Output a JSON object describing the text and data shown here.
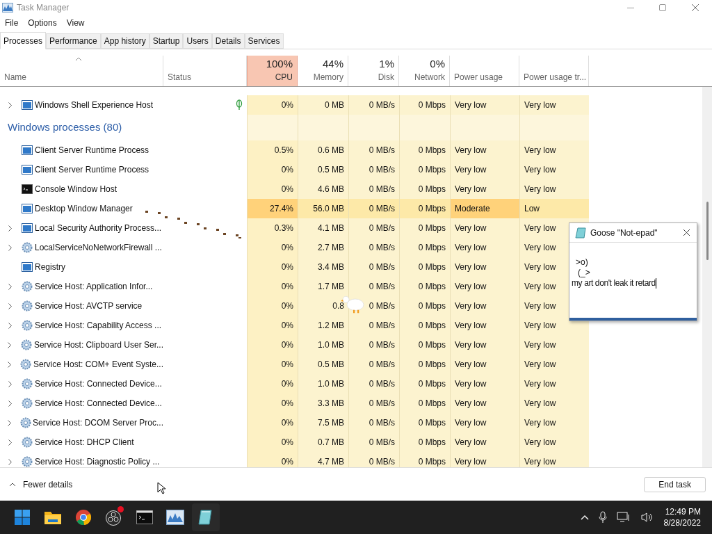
{
  "window": {
    "title": "Task Manager"
  },
  "menu": [
    "File",
    "Options",
    "View"
  ],
  "tabs": [
    {
      "label": "Processes",
      "selected": true
    },
    {
      "label": "Performance",
      "selected": false
    },
    {
      "label": "App history",
      "selected": false
    },
    {
      "label": "Startup",
      "selected": false
    },
    {
      "label": "Users",
      "selected": false
    },
    {
      "label": "Details",
      "selected": false
    },
    {
      "label": "Services",
      "selected": false
    }
  ],
  "columns": [
    {
      "name": "Name"
    },
    {
      "name": "Status"
    },
    {
      "name": "CPU",
      "total": "100%"
    },
    {
      "name": "Memory",
      "total": "44%"
    },
    {
      "name": "Disk",
      "total": "1%"
    },
    {
      "name": "Network",
      "total": "0%"
    },
    {
      "name": "Power usage"
    },
    {
      "name": "Power usage tr..."
    }
  ],
  "top_row": {
    "name": "Windows Shell Experience Host",
    "kind": "app",
    "expandable": true,
    "status_leaf": true,
    "cells": [
      "0%",
      "0 MB",
      "0 MB/s",
      "0 Mbps",
      "Very low",
      "Very low"
    ],
    "busy": false
  },
  "group": "Windows processes (80)",
  "rows": [
    {
      "name": "Client Server Runtime Process",
      "kind": "app",
      "expandable": false,
      "cells": [
        "0.5%",
        "0.6 MB",
        "0 MB/s",
        "0 Mbps",
        "Very low",
        "Very low"
      ],
      "busy": false
    },
    {
      "name": "Client Server Runtime Process",
      "kind": "app",
      "expandable": false,
      "cells": [
        "0%",
        "0.5 MB",
        "0 MB/s",
        "0 Mbps",
        "Very low",
        "Very low"
      ],
      "busy": false
    },
    {
      "name": "Console Window Host",
      "kind": "console",
      "expandable": false,
      "cells": [
        "0%",
        "4.6 MB",
        "0 MB/s",
        "0 Mbps",
        "Very low",
        "Very low"
      ],
      "busy": false
    },
    {
      "name": "Desktop Window Manager",
      "kind": "app",
      "expandable": false,
      "cells": [
        "27.4%",
        "56.0 MB",
        "0 MB/s",
        "0 Mbps",
        "Moderate",
        "Low"
      ],
      "busy": true
    },
    {
      "name": "Local Security Authority Process...",
      "kind": "app",
      "expandable": true,
      "cells": [
        "0.3%",
        "4.1 MB",
        "0 MB/s",
        "0 Mbps",
        "Very low",
        "Very low"
      ],
      "busy": false
    },
    {
      "name": "LocalServiceNoNetworkFirewall ...",
      "kind": "gear",
      "expandable": true,
      "cells": [
        "0%",
        "2.7 MB",
        "0 MB/s",
        "0 Mbps",
        "Very low",
        "Very low"
      ],
      "busy": false
    },
    {
      "name": "Registry",
      "kind": "app",
      "expandable": false,
      "cells": [
        "0%",
        "3.4 MB",
        "0 MB/s",
        "0 Mbps",
        "Very low",
        "Very low"
      ],
      "busy": false
    },
    {
      "name": "Service Host: Application Infor...",
      "kind": "gear",
      "expandable": true,
      "cells": [
        "0%",
        "1.7 MB",
        "0 MB/s",
        "0 Mbps",
        "Very low",
        "Very low"
      ],
      "busy": false
    },
    {
      "name": "Service Host: AVCTP service",
      "kind": "gear",
      "expandable": true,
      "cells": [
        "0%",
        "0.8",
        "0 MB/s",
        "0 Mbps",
        "Very low",
        "Very low"
      ],
      "busy": false
    },
    {
      "name": "Service Host: Capability Access ...",
      "kind": "gear",
      "expandable": true,
      "cells": [
        "0%",
        "1.2 MB",
        "0 MB/s",
        "0 Mbps",
        "Very low",
        "Very low"
      ],
      "busy": false
    },
    {
      "name": "Service Host: Clipboard User Ser...",
      "kind": "gear",
      "expandable": true,
      "cells": [
        "0%",
        "1.0 MB",
        "0 MB/s",
        "0 Mbps",
        "Very low",
        "Very low"
      ],
      "busy": false
    },
    {
      "name": "Service Host: COM+ Event Syste...",
      "kind": "gear",
      "expandable": true,
      "cells": [
        "0%",
        "0.5 MB",
        "0 MB/s",
        "0 Mbps",
        "Very low",
        "Very low"
      ],
      "busy": false
    },
    {
      "name": "Service Host: Connected Device...",
      "kind": "gear",
      "expandable": true,
      "cells": [
        "0%",
        "1.0 MB",
        "0 MB/s",
        "0 Mbps",
        "Very low",
        "Very low"
      ],
      "busy": false
    },
    {
      "name": "Service Host: Connected Device...",
      "kind": "gear",
      "expandable": true,
      "cells": [
        "0%",
        "3.3 MB",
        "0 MB/s",
        "0 Mbps",
        "Very low",
        "Very low"
      ],
      "busy": false
    },
    {
      "name": "Service Host: DCOM Server Proc...",
      "kind": "gear",
      "expandable": true,
      "cells": [
        "0%",
        "7.5 MB",
        "0 MB/s",
        "0 Mbps",
        "Very low",
        "Very low"
      ],
      "busy": false
    },
    {
      "name": "Service Host: DHCP Client",
      "kind": "gear",
      "expandable": true,
      "cells": [
        "0%",
        "0.7 MB",
        "0 MB/s",
        "0 Mbps",
        "Very low",
        "Very low"
      ],
      "busy": false
    },
    {
      "name": "Service Host: Diagnostic Policy ...",
      "kind": "gear",
      "expandable": true,
      "cells": [
        "0%",
        "4.7 MB",
        "0 MB/s",
        "0 Mbps",
        "Very low",
        "Very low"
      ],
      "busy": false
    }
  ],
  "footer": {
    "toggle": "Fewer details",
    "button": "End task"
  },
  "notepad": {
    "title": "Goose \"Not-epad\"",
    "lines": [
      ">o)",
      "(_>",
      "my art don't leak it retard"
    ]
  },
  "taskbar": {
    "apps": [
      {
        "kind": "start",
        "notify": false
      },
      {
        "kind": "folder",
        "notify": false
      },
      {
        "kind": "browser",
        "notify": false
      },
      {
        "kind": "recorder",
        "notify": true
      },
      {
        "kind": "terminal",
        "notify": false
      },
      {
        "kind": "monitor",
        "notify": false
      },
      {
        "kind": "notepad",
        "notify": false
      }
    ],
    "time": "12:49 PM",
    "date": "8/28/2022"
  }
}
